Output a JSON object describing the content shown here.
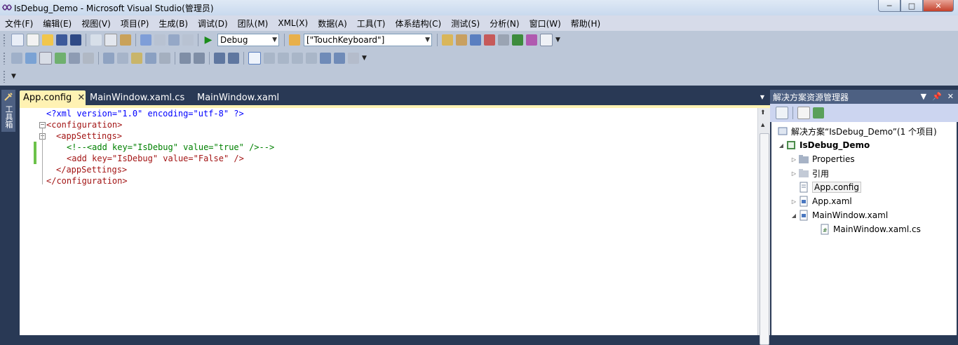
{
  "window": {
    "title": "IsDebug_Demo - Microsoft Visual Studio(管理员)"
  },
  "menu": [
    "文件(F)",
    "编辑(E)",
    "视图(V)",
    "项目(P)",
    "生成(B)",
    "调试(D)",
    "团队(M)",
    "XML(X)",
    "数据(A)",
    "工具(T)",
    "体系结构(C)",
    "测试(S)",
    "分析(N)",
    "窗口(W)",
    "帮助(H)"
  ],
  "toolbar": {
    "config_value": "Debug",
    "find_value": "[\"TouchKeyboard\"]"
  },
  "toolbox": {
    "label": "工具箱"
  },
  "tabs": [
    {
      "label": "App.config",
      "active": true
    },
    {
      "label": "MainWindow.xaml.cs",
      "active": false
    },
    {
      "label": "MainWindow.xaml",
      "active": false
    }
  ],
  "code": {
    "l1_decl": "<?xml version=\"1.0\" encoding=\"utf-8\" ?>",
    "l2_open": "<configuration>",
    "l3_open": "<appSettings>",
    "l4_comment": "<!--<add key=\"IsDebug\" value=\"true\" />-->",
    "l5": "<add key=\"IsDebug\" value=\"False\" />",
    "l6_close": "</appSettings>",
    "l7_close": "</configuration>"
  },
  "solution_explorer": {
    "title": "解决方案资源管理器",
    "solution": "解决方案“IsDebug_Demo”(1 个项目)",
    "project": "IsDebug_Demo",
    "items": [
      {
        "label": "Properties"
      },
      {
        "label": "引用"
      },
      {
        "label": "App.config"
      },
      {
        "label": "App.xaml"
      },
      {
        "label": "MainWindow.xaml"
      },
      {
        "label": "MainWindow.xaml.cs"
      }
    ]
  },
  "colors": {
    "accent_tab": "#fff2b3",
    "chrome": "#293955",
    "change_bar": "#6cc24a"
  }
}
